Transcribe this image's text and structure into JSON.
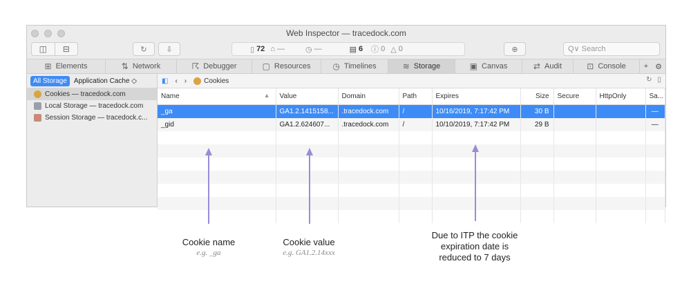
{
  "window": {
    "title": "Web Inspector — tracedock.com"
  },
  "toolbar": {
    "resource_count": "72",
    "dash1": "—",
    "dash2": "—",
    "log_count": "6",
    "error_count": "0",
    "warning_count": "0",
    "search_placeholder": "Q∨ Search"
  },
  "tabs": [
    {
      "label": "Elements",
      "icon": "elements-icon",
      "glyph": "⊞"
    },
    {
      "label": "Network",
      "icon": "network-icon",
      "glyph": "⇅"
    },
    {
      "label": "Debugger",
      "icon": "debugger-icon",
      "glyph": "☈"
    },
    {
      "label": "Resources",
      "icon": "resources-icon",
      "glyph": "▢"
    },
    {
      "label": "Timelines",
      "icon": "timelines-icon",
      "glyph": "◷"
    },
    {
      "label": "Storage",
      "icon": "storage-icon",
      "glyph": "≋"
    },
    {
      "label": "Canvas",
      "icon": "canvas-icon",
      "glyph": "▣"
    },
    {
      "label": "Audit",
      "icon": "audit-icon",
      "glyph": "⇄"
    },
    {
      "label": "Console",
      "icon": "console-icon",
      "glyph": "⊡"
    }
  ],
  "sidebar": {
    "filter_all": "All Storage",
    "filter_cache": "Application Cache ◇",
    "items": [
      {
        "label": "Cookies — tracedock.com",
        "icon": "cookie-icon",
        "color": "#d9a441"
      },
      {
        "label": "Local Storage — tracedock.com",
        "icon": "local-storage-icon",
        "color": "#9aa0a8"
      },
      {
        "label": "Session Storage — tracedock.c...",
        "icon": "session-storage-icon",
        "color": "#c98a7a"
      }
    ]
  },
  "nav": {
    "crumb": "Cookies"
  },
  "table": {
    "headers": [
      "Name",
      "Value",
      "Domain",
      "Path",
      "Expires",
      "Size",
      "Secure",
      "HttpOnly",
      "Sa..."
    ],
    "rows": [
      [
        "_ga",
        "GA1.2.1415158...",
        ".tracedock.com",
        "/",
        "10/16/2019, 7:17:42 PM",
        "30 B",
        "",
        "",
        "—"
      ],
      [
        "_gid",
        "GA1.2.624607...",
        ".tracedock.com",
        "/",
        "10/10/2019, 7:17:42 PM",
        "29 B",
        "",
        "",
        "—"
      ]
    ]
  },
  "annotations": {
    "name_title": "Cookie name",
    "name_sub": "e.g. _ga",
    "value_title": "Cookie value",
    "value_sub": "e.g. GA1.2.14xxx",
    "itp_line1": "Due to ITP the cookie",
    "itp_line2": "expiration date is",
    "itp_line3": "reduced to 7 days"
  },
  "colors": {
    "accent": "#3d8bf6",
    "annotation_arrow": "#9b8ad6"
  }
}
